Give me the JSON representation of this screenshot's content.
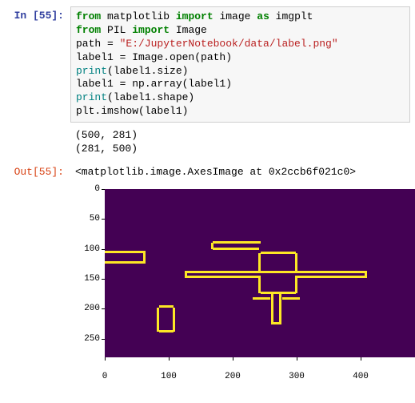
{
  "in_prompt": "In [55]:",
  "out_prompt": "Out[55]:",
  "code": {
    "kw_from1": "from",
    "matplotlib": " matplotlib ",
    "kw_import1": "import",
    "image": " image ",
    "kw_as": "as",
    "imgplt": " imgplt",
    "kw_from2": "from",
    "pil": " PIL ",
    "kw_import2": "import",
    "image2": " Image",
    "path_assign": "path = ",
    "path_str": "\"E:/JupyterNotebook/data/label.png\"",
    "line4": "label1 = Image.open(path)",
    "print1": "print",
    "size_arg": "(label1.size)",
    "line6": "label1 = np.array(label1)",
    "print2": "print",
    "shape_arg": "(label1.shape)",
    "line8": "plt.imshow(label1)"
  },
  "output_text": "(500, 281)\n(281, 500)",
  "result_text": "<matplotlib.image.AxesImage at 0x2ccb6f021c0>",
  "chart_data": {
    "type": "heatmap",
    "xlabel": "",
    "ylabel": "",
    "xlim": [
      0,
      500
    ],
    "ylim": [
      281,
      0
    ],
    "x_ticks": [
      0,
      100,
      200,
      300,
      400
    ],
    "y_ticks": [
      0,
      50,
      100,
      150,
      200,
      250
    ],
    "description": "Binary label image (281×500) shown with viridis colormap: dark purple background (value 0), yellow foreground outlines (value 1) depicting aircraft silhouette edges and small blobs."
  }
}
